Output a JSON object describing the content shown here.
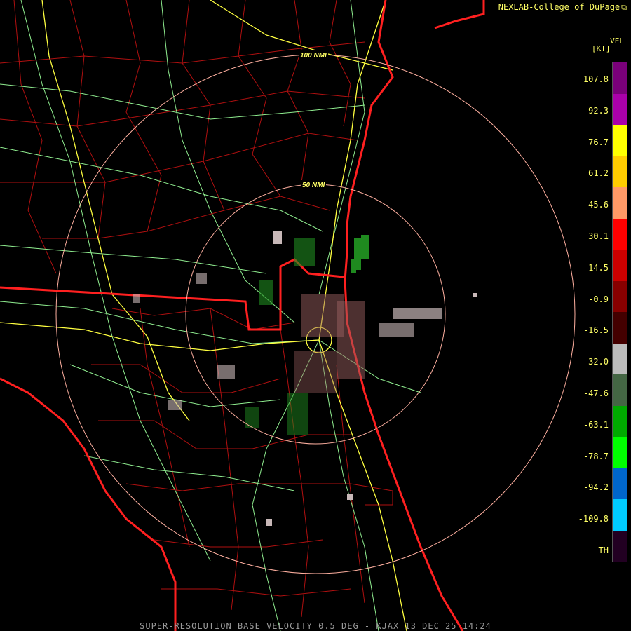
{
  "header": {
    "source": "NEXLAB-College of DuPage",
    "external_link_icon": "external-link-icon"
  },
  "legend": {
    "product": "VEL",
    "unit": "[KT]",
    "ticks": [
      "107.8",
      "92.3",
      "76.7",
      "61.2",
      "45.6",
      "30.1",
      "14.5",
      "-0.9",
      "-16.5",
      "-32.0",
      "-47.6",
      "-63.1",
      "-78.7",
      "-94.2",
      "-109.8",
      "TH"
    ],
    "colors": [
      "#7a007a",
      "#aa00aa",
      "#ffff00",
      "#ffcc00",
      "#ff9966",
      "#ff0000",
      "#cc0000",
      "#880000",
      "#440000",
      "#bbbbbb",
      "#446644",
      "#00aa00",
      "#00ff00",
      "#0066cc",
      "#00ccff",
      "#220022"
    ]
  },
  "range_rings": [
    {
      "label": "100 NMI",
      "radius_nmi": 100
    },
    {
      "label": "50 NMI",
      "radius_nmi": 50
    }
  ],
  "footer": {
    "product_line": "SUPER-RESOLUTION BASE VELOCITY 0.5 DEG - KJAX 13 DEC 25 14:24"
  },
  "map_colors": {
    "state_border": "#ff2020",
    "county_border": "#b01010",
    "highway": "#ffff40",
    "road": "#90ee90",
    "ring": "#ffb0a0",
    "background": "#000000"
  }
}
